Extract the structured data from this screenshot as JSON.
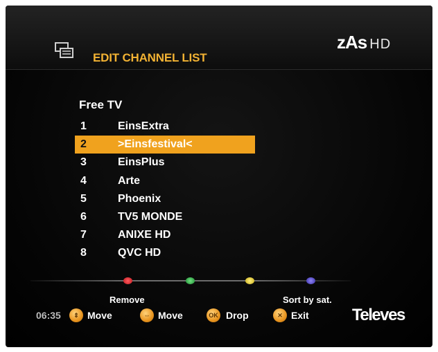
{
  "header": {
    "title": "EDIT CHANNEL LIST",
    "brand": "zAs",
    "brand_suffix": "HD",
    "icon": "channel-list-icon"
  },
  "group": {
    "label": "Free TV"
  },
  "channels": [
    {
      "number": "1",
      "name": "EinsExtra",
      "selected": false
    },
    {
      "number": "2",
      "name": ">Einsfestival<",
      "selected": true
    },
    {
      "number": "3",
      "name": "EinsPlus",
      "selected": false
    },
    {
      "number": "4",
      "name": "Arte",
      "selected": false
    },
    {
      "number": "5",
      "name": "Phoenix",
      "selected": false
    },
    {
      "number": "6",
      "name": "TV5 MONDE",
      "selected": false
    },
    {
      "number": "7",
      "name": "ANIXE HD",
      "selected": false
    },
    {
      "number": "8",
      "name": "QVC HD",
      "selected": false
    }
  ],
  "color_keys": [
    {
      "color": "#e0262c",
      "label": "Remove"
    },
    {
      "color": "#2fb04a",
      "label": ""
    },
    {
      "color": "#e8cf3a",
      "label": ""
    },
    {
      "color": "#5b4fd0",
      "label": "Sort by sat."
    }
  ],
  "footer": {
    "time": "06:35",
    "buttons": [
      {
        "icon": "up-down-arrows-icon",
        "glyph": "⇕",
        "label": "Move"
      },
      {
        "icon": "left-right-arrows-icon",
        "glyph": "⇔",
        "label": "Move"
      },
      {
        "icon": "ok-button-icon",
        "glyph": "OK",
        "label": "Drop"
      },
      {
        "icon": "exit-x-icon",
        "glyph": "✕",
        "label": "Exit"
      }
    ],
    "logo": "Televes"
  },
  "colors": {
    "accent": "#f0a21e",
    "title": "#f2b233",
    "background": "#050505"
  }
}
